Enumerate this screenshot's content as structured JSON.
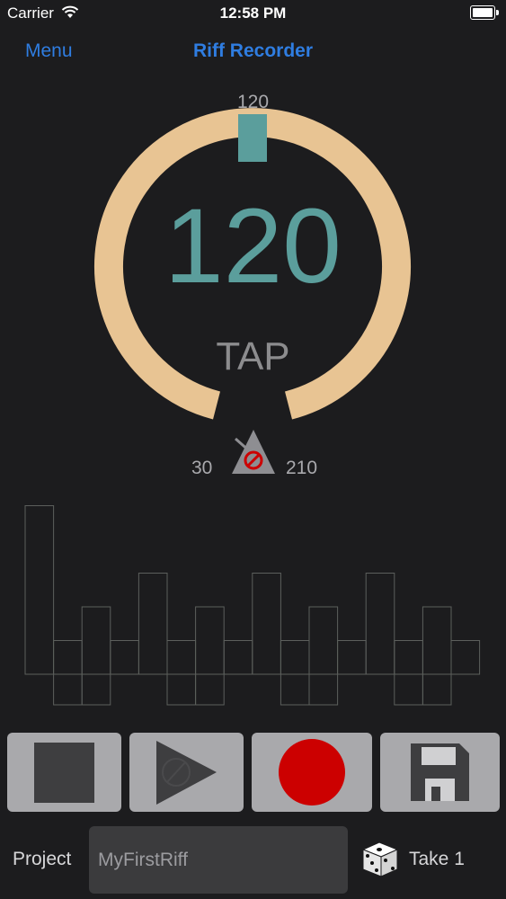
{
  "status_bar": {
    "carrier": "Carrier",
    "time": "12:58 PM"
  },
  "nav": {
    "menu_label": "Menu",
    "title": "Riff Recorder",
    "accent": "#2f7de1"
  },
  "dial": {
    "indicator_value": "120",
    "tempo": "120",
    "tap_label": "TAP",
    "min": "30",
    "max": "210",
    "ring_color": "#e8c493",
    "tempo_color": "#5b9e9c",
    "metronome_icon": "metronome-disabled-icon"
  },
  "pattern": {
    "beats": [
      5,
      1,
      2,
      1,
      3,
      1,
      2,
      1,
      3,
      1,
      2,
      1,
      3,
      1,
      2,
      1
    ],
    "sub_beats": [
      0,
      1,
      1,
      0,
      0,
      1,
      1,
      0,
      0,
      1,
      1,
      0,
      0,
      1,
      1,
      0
    ]
  },
  "transport": {
    "stop_icon": "stop-icon",
    "play_icon": "play-icon",
    "record_icon": "record-icon",
    "save_icon": "save-icon",
    "record_color": "#cc0000"
  },
  "footer": {
    "project_label": "Project",
    "project_name": "MyFirstRiff",
    "dice_icon": "dice-icon",
    "take_label": "Take 1"
  }
}
